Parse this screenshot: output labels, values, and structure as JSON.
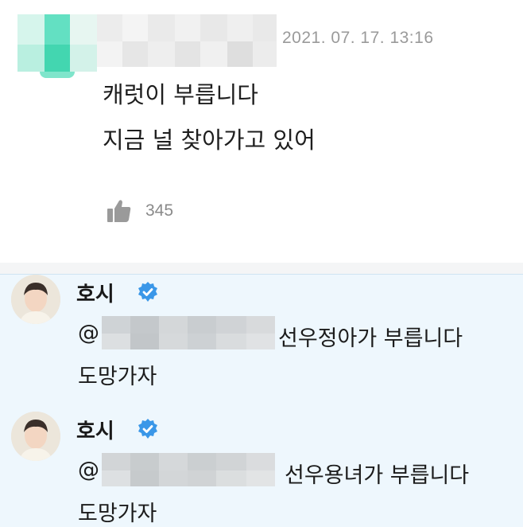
{
  "comment": {
    "timestamp": "2021. 07. 17. 13:16",
    "lines": [
      "캐럿이 부릅니다",
      "지금 널 찾아가고 있어"
    ],
    "likes": "345",
    "like_icon": "thumbs-up-icon"
  },
  "replies": [
    {
      "author": "호시",
      "verified_icon": "verified-badge-icon",
      "at_prefix": "@",
      "rest": "선우정아가 부릅니다",
      "line2": "도망가자"
    },
    {
      "author": "호시",
      "verified_icon": "verified-badge-icon",
      "at_prefix": "@",
      "rest": "선우용녀가 부릅니다",
      "line2": "도망가자"
    }
  ],
  "colors": {
    "timestamp": "#9a9a9a",
    "reply_bg": "#eef7fd",
    "verified": "#3a97e8"
  }
}
